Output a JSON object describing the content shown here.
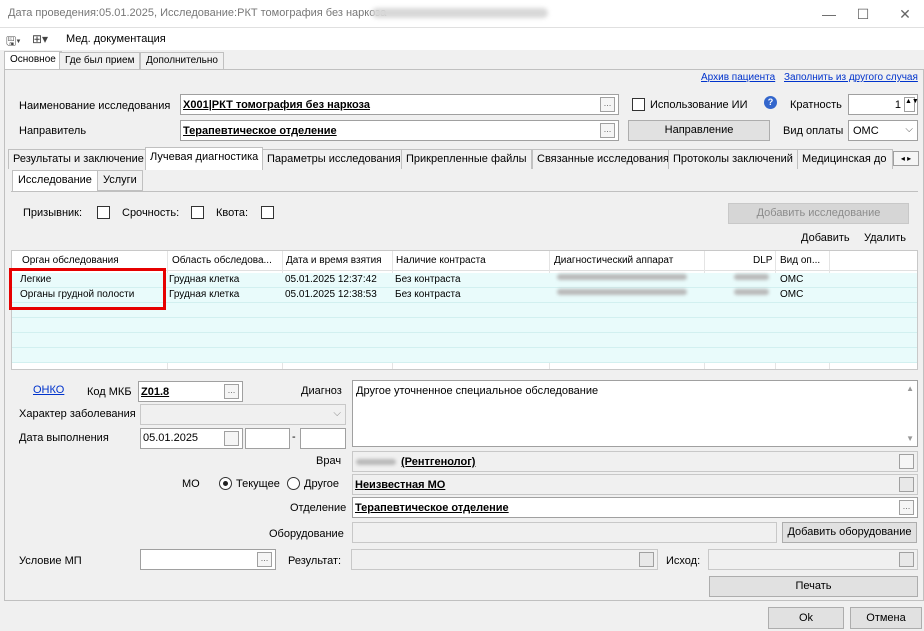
{
  "window": {
    "title": "Дата проведения:05.01.2025, Исследование:РКТ томография без наркоза - ",
    "minimize": "—",
    "maximize": "☐",
    "close": "✕"
  },
  "menubar": {
    "med_docs": "Мед. документация"
  },
  "top_tabs": [
    "Основное",
    "Где был прием",
    "Дополнительно"
  ],
  "links": {
    "archive": "Архив пациента",
    "fill_from_other": "Заполнить из другого случая"
  },
  "study": {
    "label": "Наименование исследования",
    "value": "X001|РКТ томография без наркоза",
    "ai_label": "Использование ИИ",
    "multiplicity_label": "Кратность",
    "multiplicity_value": "1"
  },
  "referrer": {
    "label": "Направитель",
    "value": "Терапевтическое отделение",
    "direction_button": "Направление",
    "payment_label": "Вид оплаты",
    "payment_value": "ОМС"
  },
  "section_tabs": [
    "Результаты и заключение",
    "Лучевая диагностика",
    "Параметры исследования",
    "Прикрепленные файлы",
    "Связанные исследования",
    "Протоколы заключений",
    "Медицинская до"
  ],
  "inner_tabs": [
    "Исследование",
    "Услуги"
  ],
  "flags": {
    "conscript": "Призывник:",
    "urgency": "Срочность:",
    "quota": "Квота:"
  },
  "add_study_button": "Добавить исследование",
  "grid_actions": {
    "add": "Добавить",
    "delete": "Удалить"
  },
  "grid": {
    "columns": [
      "Орган обследования",
      "Область обследова...",
      "Дата и время взятия",
      "Наличие контраста",
      "Диагностический аппарат",
      "DLP",
      "Вид оп..."
    ],
    "rows": [
      [
        "Легкие",
        "Грудная клетка",
        "05.01.2025 12:37:42",
        "Без контраста",
        "",
        "",
        "ОМС"
      ],
      [
        "Органы грудной полости",
        "Грудная клетка",
        "05.01.2025 12:38:53",
        "Без контраста",
        "",
        "",
        "ОМС"
      ]
    ]
  },
  "lower": {
    "onko_link": "ОНКО",
    "mkb_label": "Код МКБ",
    "mkb_value": "Z01.8",
    "diagnosis_label": "Диагноз",
    "diagnosis_value": "Другое уточненное специальное обследование",
    "disease_label": "Характер заболевания",
    "exec_date_label": "Дата выполнения",
    "exec_date_value": "05.01.2025",
    "doctor_label": "Врач",
    "doctor_value": "(Рентгенолог)",
    "mo_label": "МО",
    "mo_current": "Текущее",
    "mo_other": "Другое",
    "mo_value": "Неизвестная МО",
    "dept_label": "Отделение",
    "dept_value": "Терапевтическое отделение",
    "equipment_label": "Оборудование",
    "add_equipment_button": "Добавить оборудование",
    "condition_label": "Условие МП",
    "result_label": "Результат:",
    "outcome_label": "Исход:",
    "print_button": "Печать"
  },
  "footer": {
    "ok": "Ok",
    "cancel": "Отмена"
  }
}
